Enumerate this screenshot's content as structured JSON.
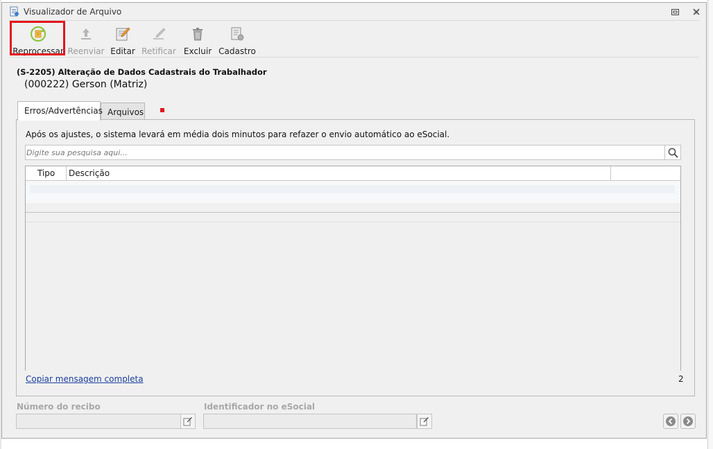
{
  "window": {
    "title": "Visualizador de Arquivo",
    "restore_icon": "restore-icon",
    "close_icon": "close-icon"
  },
  "toolbar": {
    "buttons": [
      {
        "label": "Reprocessar",
        "icon": "reprocess-icon",
        "enabled": true
      },
      {
        "label": "Reenviar",
        "icon": "upload-icon",
        "enabled": false
      },
      {
        "label": "Editar",
        "icon": "edit-icon",
        "enabled": true
      },
      {
        "label": "Retificar",
        "icon": "rectify-icon",
        "enabled": false
      },
      {
        "label": "Excluir",
        "icon": "trash-icon",
        "enabled": true
      },
      {
        "label": "Cadastro",
        "icon": "register-icon",
        "enabled": true
      }
    ],
    "highlight_color": "#e3141d"
  },
  "event": {
    "title": "(S-2205) Alteração de Dados Cadastrais do Trabalhador",
    "company": "(000222) Gerson (Matriz)"
  },
  "tabs": [
    {
      "label": "Erros/Advertências",
      "active": true
    },
    {
      "label": "Arquivos",
      "active": false
    }
  ],
  "panel": {
    "info": "Após os ajustes, o sistema levará em média dois minutos para refazer o envio automático ao eSocial.",
    "search_placeholder": "Digite sua pesquisa aqui...",
    "columns": [
      "Tipo",
      "Descrição",
      ""
    ],
    "copy_link": "Copiar mensagem completa",
    "count": "2"
  },
  "footer": {
    "receipt_label": "Número do recibo",
    "receipt_value": "",
    "esocial_label": "Identificador no eSocial",
    "esocial_value": ""
  }
}
